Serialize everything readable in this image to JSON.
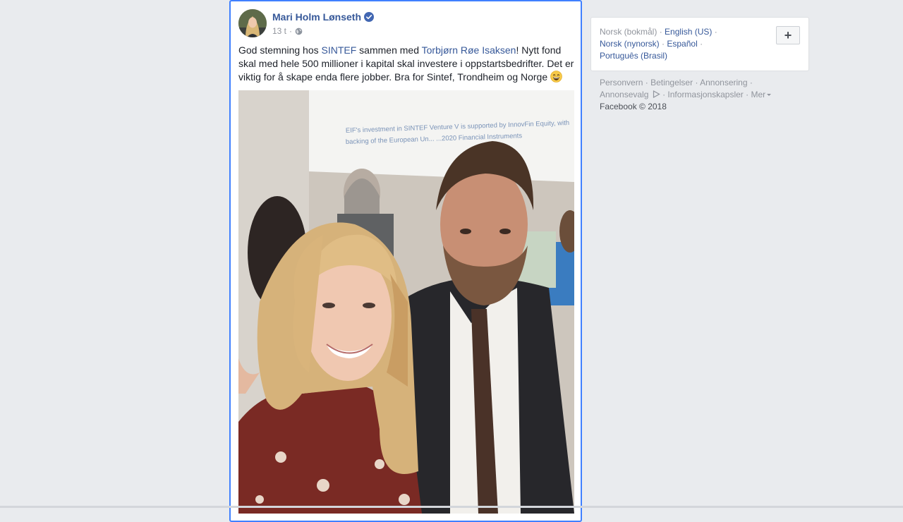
{
  "post": {
    "author": "Mari Holm Lønseth",
    "time": "13 t",
    "dot": "·",
    "text": {
      "p1": "God stemning hos ",
      "link1": "SINTEF",
      "p2": " sammen med ",
      "link2": "Torbjørn Røe Isaksen",
      "p3": "! Nytt fond skal med hele 500 millioner i kapital skal investere i oppstartsbedrifter. Det er viktig for å skape enda flere jobber. Bra for Sintef, Trondheim og Norge"
    },
    "photo": {
      "screen_text_line1": "EIF's investment in SINTEF Venture V is supported by InnovFin Equity, with",
      "screen_text_line2": "backing of the European Un...                        ...2020 Financial Instruments"
    }
  },
  "languages": {
    "current": "Norsk (bokmål)",
    "options": [
      "English (US)",
      "Norsk (nynorsk)",
      "Español",
      "Português (Brasil)"
    ],
    "sep": "·",
    "add_label": "+"
  },
  "footer": {
    "links": [
      "Personvern",
      "Betingelser",
      "Annonsering",
      "Annonsevalg",
      "Informasjonskapsler",
      "Mer"
    ],
    "sep": "·",
    "copyright": "Facebook © 2018"
  },
  "colors": {
    "link": "#365899",
    "background": "#e9ebee",
    "focus_border": "#4080ff"
  }
}
